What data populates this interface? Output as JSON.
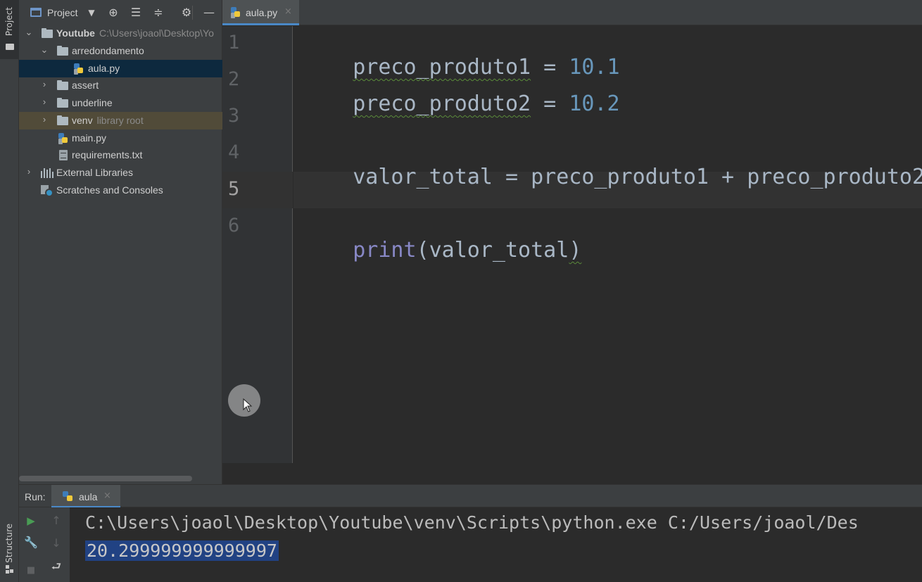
{
  "left_strip": {
    "project_label": "Project",
    "structure_label": "Structure"
  },
  "project_panel": {
    "title": "Project",
    "toolbar_icons": [
      "crosshair-icon",
      "expand-all-icon",
      "collapse-all-icon",
      "gear-icon",
      "minimize-icon"
    ],
    "tree": {
      "root": {
        "label": "Youtube",
        "path": "C:\\Users\\joaol\\Desktop\\Yo"
      },
      "items": [
        {
          "label": "arredondamento",
          "type": "folder",
          "expanded": true
        },
        {
          "label": "aula.py",
          "type": "python-file",
          "selected": true
        },
        {
          "label": "assert",
          "type": "folder",
          "expanded": false
        },
        {
          "label": "underline",
          "type": "folder",
          "expanded": false
        },
        {
          "label": "venv",
          "type": "folder",
          "hint": "library root",
          "expanded": false
        },
        {
          "label": "main.py",
          "type": "python-file"
        },
        {
          "label": "requirements.txt",
          "type": "text-file"
        },
        {
          "label": "External Libraries",
          "type": "library"
        },
        {
          "label": "Scratches and Consoles",
          "type": "scratches"
        }
      ]
    }
  },
  "editor": {
    "tab": {
      "label": "aula.py",
      "close": "×"
    },
    "line_numbers": [
      "1",
      "2",
      "3",
      "4",
      "5",
      "6"
    ],
    "current_line": "5",
    "lines": {
      "l1": {
        "name": "preco_produto1",
        "op": " = ",
        "value": "10.1"
      },
      "l2": {
        "name": "preco_produto2",
        "op": " = ",
        "value": "10.2"
      },
      "l4": {
        "target": "valor_total",
        "op": " = ",
        "a": "preco_produto1",
        "plus": " + ",
        "b": "preco_produto2"
      },
      "l6": {
        "fn": "print",
        "open": "(",
        "arg": "valor_total",
        "close": ")"
      }
    }
  },
  "run_panel": {
    "title": "Run:",
    "tab": {
      "label": "aula",
      "close": "×"
    },
    "tools": [
      "run-icon",
      "up-arrow-icon",
      "wrench-icon",
      "down-arrow-icon",
      "stop-icon",
      "soft-wrap-icon"
    ],
    "console": {
      "command": "C:\\Users\\joaol\\Desktop\\Youtube\\venv\\Scripts\\python.exe C:/Users/joaol/Des",
      "output": "20.299999999999997"
    }
  },
  "colors": {
    "background": "#2b2b2b",
    "panel": "#3c3f41",
    "number": "#6897bb",
    "builtin": "#8888c6",
    "selection": "#214283",
    "accent": "#4a88c7"
  }
}
